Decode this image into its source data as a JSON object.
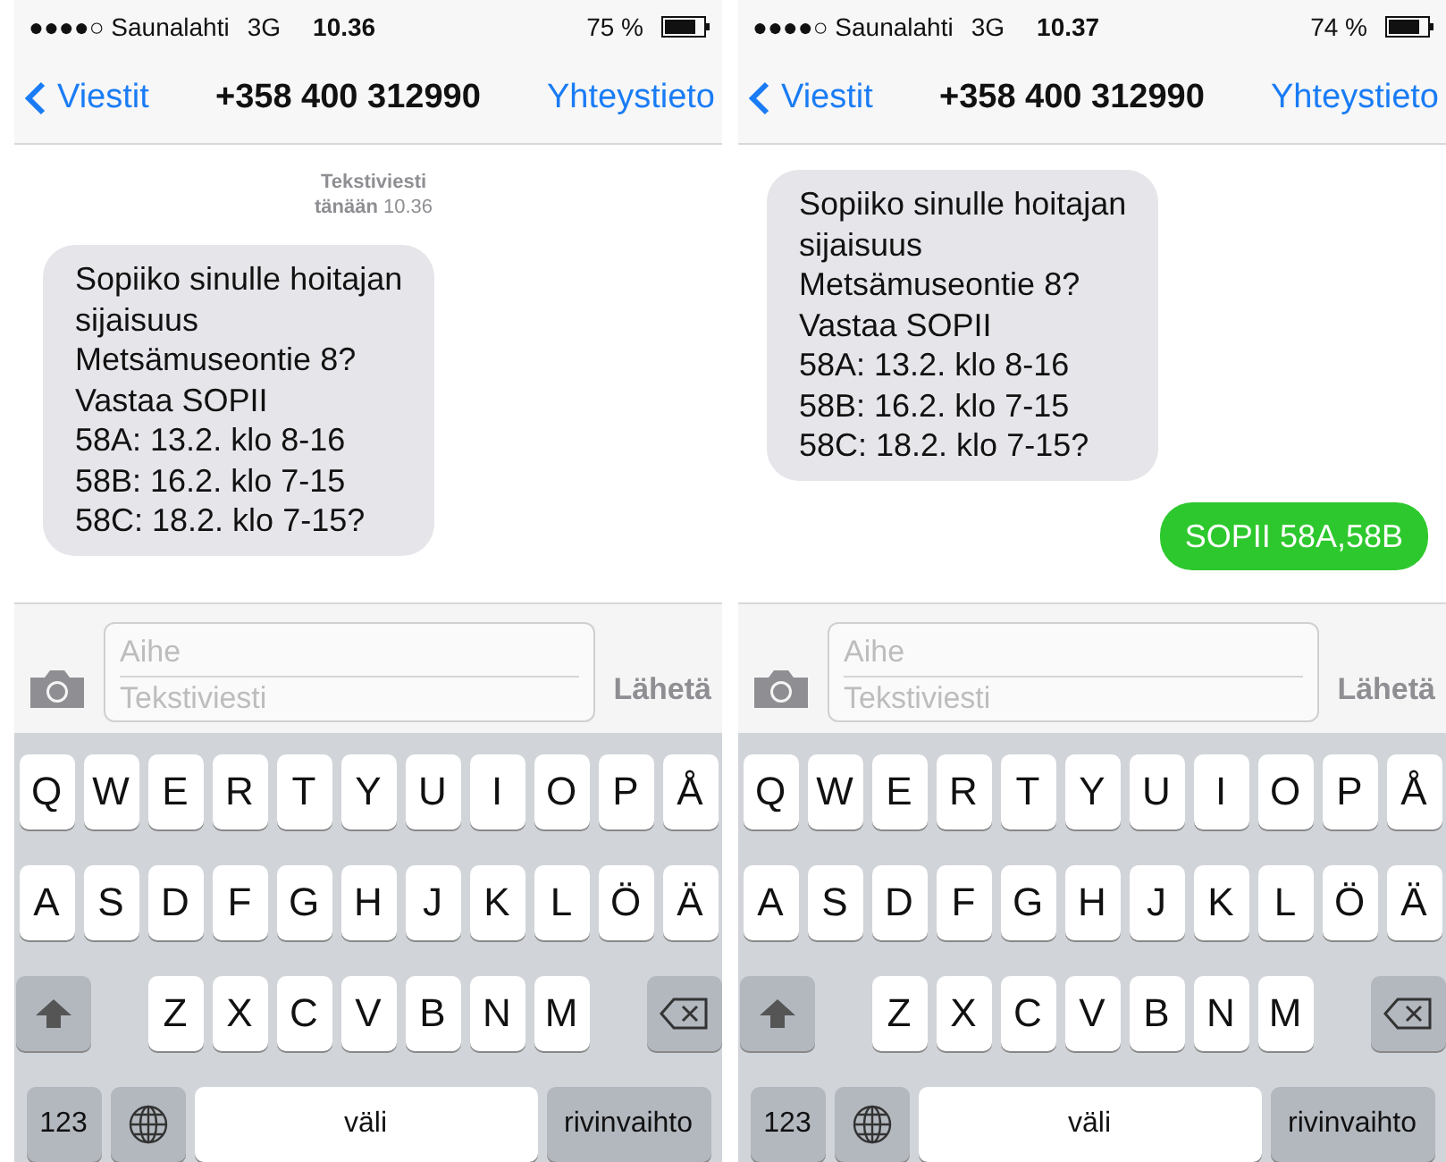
{
  "phones": [
    {
      "status": {
        "carrier": "●●●●○ Saunalahti",
        "network": "3G",
        "time": "10.36",
        "battery": "75 %"
      },
      "nav": {
        "back": "Viestit",
        "title": "+358 400 312990",
        "action": "Yhteystieto"
      },
      "timestamp": {
        "label": "Tekstiviesti",
        "day": "tänään",
        "time": "10.36"
      },
      "messages": [
        {
          "kind": "received",
          "lines": [
            "Sopiiko sinulle hoitajan",
            "sijaisuus",
            "Metsämuseontie 8?",
            "Vastaa SOPII",
            "58A: 13.2. klo 8-16",
            "58B: 16.2. klo 7-15",
            "58C: 18.2. klo 7-15?"
          ]
        }
      ],
      "composer": {
        "subject_placeholder": "Aihe",
        "body_placeholder": "Tekstiviesti",
        "send": "Lähetä"
      },
      "keyboard": {
        "top_keys": [
          "Q",
          "W",
          "E",
          "R",
          "T",
          "Y",
          "U",
          "I",
          "O",
          "P",
          "Å"
        ],
        "middle_keys": [
          "A",
          "S",
          "D",
          "F",
          "G",
          "H",
          "J",
          "K",
          "L",
          "Ö",
          "Ä"
        ],
        "bottom_keys": [
          "Z",
          "X",
          "C",
          "V",
          "B",
          "N",
          "M"
        ],
        "numbers": "123",
        "space": "väli",
        "return": "rivinvaihto"
      }
    },
    {
      "status": {
        "carrier": "●●●●○ Saunalahti",
        "network": "3G",
        "time": "10.37",
        "battery": "74 %"
      },
      "nav": {
        "back": "Viestit",
        "title": "+358 400 312990",
        "action": "Yhteystieto"
      },
      "messages": [
        {
          "kind": "received",
          "lines": [
            "Sopiiko sinulle hoitajan",
            "sijaisuus",
            "Metsämuseontie 8?",
            "Vastaa SOPII",
            "58A: 13.2. klo 8-16",
            "58B: 16.2. klo 7-15",
            "58C: 18.2. klo 7-15?"
          ]
        },
        {
          "kind": "sent",
          "lines": [
            "SOPII 58A,58B"
          ]
        }
      ],
      "composer": {
        "subject_placeholder": "Aihe",
        "body_placeholder": "Tekstiviesti",
        "send": "Lähetä"
      },
      "keyboard": {
        "top_keys": [
          "Q",
          "W",
          "E",
          "R",
          "T",
          "Y",
          "U",
          "I",
          "O",
          "P",
          "Å"
        ],
        "middle_keys": [
          "A",
          "S",
          "D",
          "F",
          "G",
          "H",
          "J",
          "K",
          "L",
          "Ö",
          "Ä"
        ],
        "bottom_keys": [
          "Z",
          "X",
          "C",
          "V",
          "B",
          "N",
          "M"
        ],
        "numbers": "123",
        "space": "väli",
        "return": "rivinvaihto"
      }
    }
  ]
}
